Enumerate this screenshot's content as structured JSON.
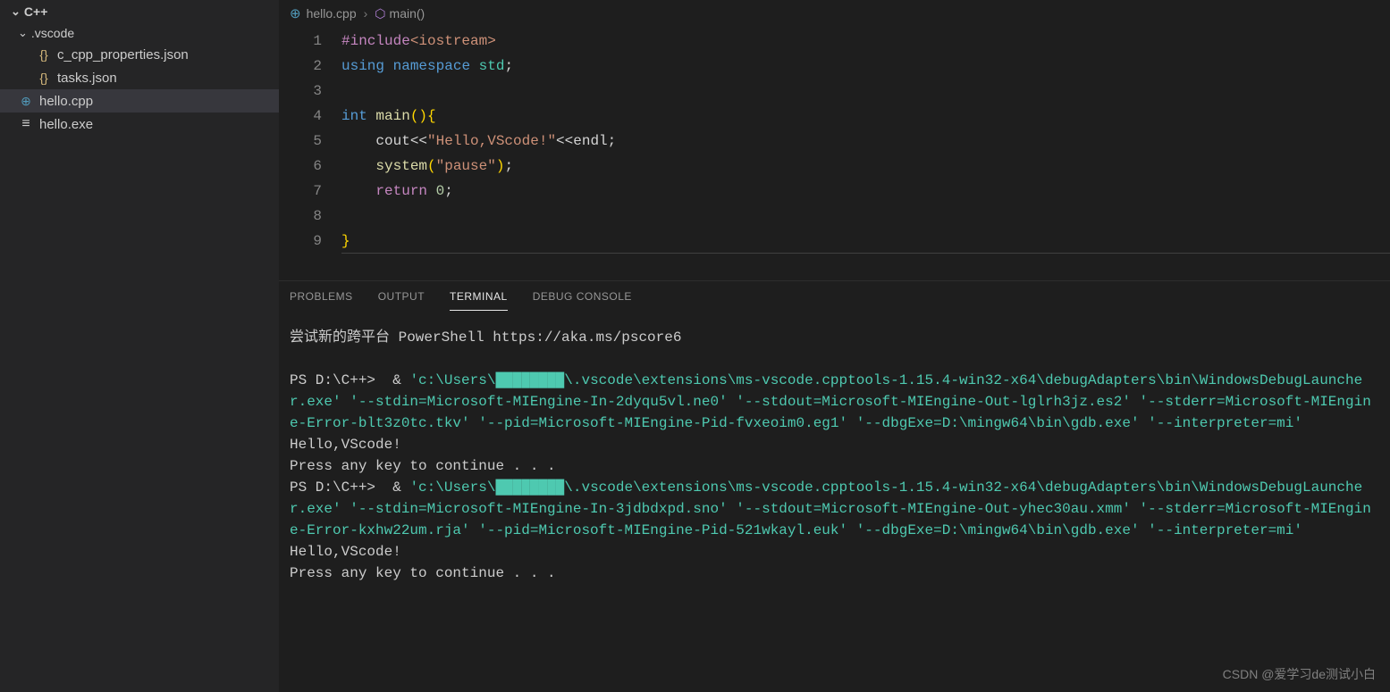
{
  "sidebar": {
    "project_name": "C++",
    "folder": ".vscode",
    "files": [
      {
        "name": "c_cpp_properties.json",
        "icon": "json"
      },
      {
        "name": "tasks.json",
        "icon": "json"
      }
    ],
    "root_files": [
      {
        "name": "hello.cpp",
        "icon": "cpp",
        "active": true
      },
      {
        "name": "hello.exe",
        "icon": "exe"
      }
    ]
  },
  "breadcrumb": {
    "file": "hello.cpp",
    "symbol": "main()"
  },
  "code": {
    "line_numbers": [
      "1",
      "2",
      "3",
      "4",
      "5",
      "6",
      "7",
      "8",
      "9"
    ],
    "lines": {
      "l1_include": "#include",
      "l1_header": "<iostream>",
      "l2_using": "using",
      "l2_namespace": "namespace",
      "l2_std": "std",
      "l2_semi": ";",
      "l4_int": "int",
      "l4_main": "main",
      "l4_paren": "(){",
      "l5_cout": "cout",
      "l5_op1": "<<",
      "l5_str": "\"Hello,VScode!\"",
      "l5_op2": "<<",
      "l5_endl": "endl",
      "l5_semi": ";",
      "l6_system": "system",
      "l6_paren1": "(",
      "l6_str": "\"pause\"",
      "l6_paren2": ")",
      "l6_semi": ";",
      "l7_return": "return",
      "l7_zero": "0",
      "l7_semi": ";",
      "l9_brace": "}"
    }
  },
  "panel": {
    "tabs": {
      "problems": "PROBLEMS",
      "output": "OUTPUT",
      "terminal": "TERMINAL",
      "debug_console": "DEBUG CONSOLE"
    }
  },
  "terminal": {
    "banner": "尝试新的跨平台 PowerShell https://aka.ms/pscore6",
    "prompt": "PS D:\\C++> ",
    "amp": " & ",
    "cmd1": "'c:\\Users\\████████\\.vscode\\extensions\\ms-vscode.cpptools-1.15.4-win32-x64\\debugAdapters\\bin\\WindowsDebugLauncher.exe' '--stdin=Microsoft-MIEngine-In-2dyqu5vl.ne0' '--stdout=Microsoft-MIEngine-Out-lglrh3jz.es2' '--stderr=Microsoft-MIEngine-Error-blt3z0tc.tkv' '--pid=Microsoft-MIEngine-Pid-fvxeoim0.eg1' '--dbgExe=D:\\mingw64\\bin\\gdb.exe' '--interpreter=mi'",
    "out1a": "Hello,VScode!",
    "out1b": "Press any key to continue . . .",
    "cmd2": "'c:\\Users\\████████\\.vscode\\extensions\\ms-vscode.cpptools-1.15.4-win32-x64\\debugAdapters\\bin\\WindowsDebugLauncher.exe' '--stdin=Microsoft-MIEngine-In-3jdbdxpd.sno' '--stdout=Microsoft-MIEngine-Out-yhec30au.xmm' '--stderr=Microsoft-MIEngine-Error-kxhw22um.rja' '--pid=Microsoft-MIEngine-Pid-521wkayl.euk' '--dbgExe=D:\\mingw64\\bin\\gdb.exe' '--interpreter=mi'",
    "out2a": "Hello,VScode!",
    "out2b": "Press any key to continue . . ."
  },
  "watermark": "CSDN @爱学习de测试小白"
}
